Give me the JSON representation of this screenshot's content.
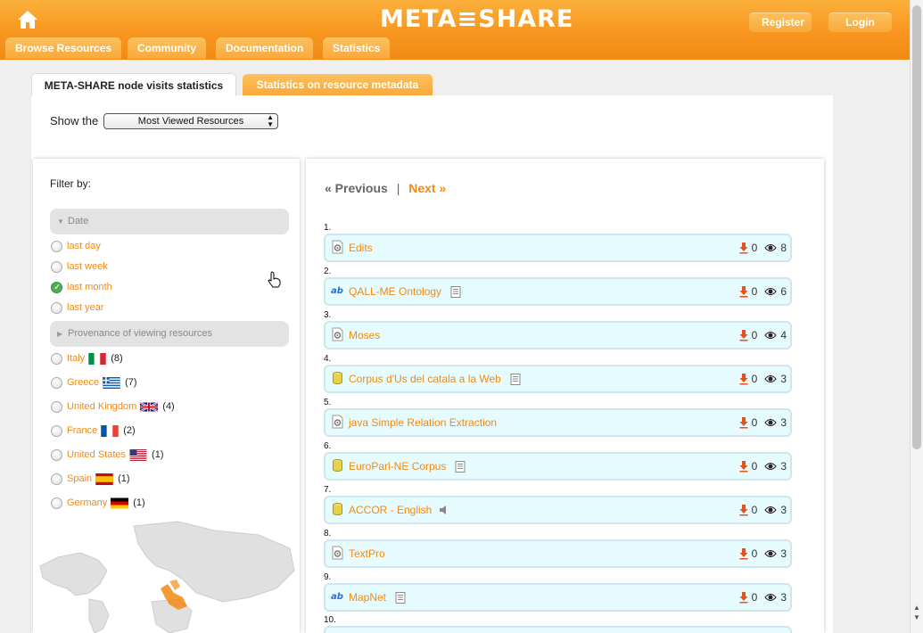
{
  "header": {
    "logo": "META≡SHARE",
    "register_label": "Register",
    "login_label": "Login",
    "nav": [
      "Browse Resources",
      "Community",
      "Documentation",
      "Statistics"
    ]
  },
  "tabs": {
    "active": "META-SHARE node visits statistics",
    "inactive": "Statistics on resource metadata"
  },
  "show": {
    "label": "Show the",
    "selected": "Most Viewed Resources"
  },
  "filter": {
    "title": "Filter by:",
    "date_facet": "Date",
    "date_options": [
      "last day",
      "last week",
      "last month",
      "last year"
    ],
    "date_selected": "last month",
    "provenance_facet": "Provenance of viewing resources",
    "countries": [
      {
        "name": "Italy",
        "count": "(8)",
        "flag": "italy"
      },
      {
        "name": "Greece",
        "count": "(7)",
        "flag": "greece"
      },
      {
        "name": "United Kingdom",
        "count": "(4)",
        "flag": "uk"
      },
      {
        "name": "France",
        "count": "(2)",
        "flag": "france"
      },
      {
        "name": "United States",
        "count": "(1)",
        "flag": "usa"
      },
      {
        "name": "Spain",
        "count": "(1)",
        "flag": "spain"
      },
      {
        "name": "Germany",
        "count": "(1)",
        "flag": "germany"
      }
    ]
  },
  "pager": {
    "previous": "« Previous",
    "separator": "|",
    "next": "Next »"
  },
  "resources": [
    {
      "rank": "1.",
      "name": "Edits",
      "type": "tool",
      "extra": "",
      "downloads": "0",
      "views": "8"
    },
    {
      "rank": "2.",
      "name": "QALL-ME Ontology",
      "type": "lexical",
      "extra": "doc",
      "downloads": "0",
      "views": "6"
    },
    {
      "rank": "3.",
      "name": "Moses",
      "type": "tool",
      "extra": "",
      "downloads": "0",
      "views": "4"
    },
    {
      "rank": "4.",
      "name": "Corpus d'Us del catala a la Web",
      "type": "corpus",
      "extra": "doc",
      "downloads": "0",
      "views": "3"
    },
    {
      "rank": "5.",
      "name": "java Simple Relation Extraction",
      "type": "tool",
      "extra": "",
      "downloads": "0",
      "views": "3"
    },
    {
      "rank": "6.",
      "name": "EuroParl-NE Corpus",
      "type": "corpus",
      "extra": "doc",
      "downloads": "0",
      "views": "3"
    },
    {
      "rank": "7.",
      "name": "ACCOR - English",
      "type": "corpus",
      "extra": "audio",
      "downloads": "0",
      "views": "3"
    },
    {
      "rank": "8.",
      "name": "TextPro",
      "type": "tool",
      "extra": "",
      "downloads": "0",
      "views": "3"
    },
    {
      "rank": "9.",
      "name": "MapNet",
      "type": "lexical",
      "extra": "doc",
      "downloads": "0",
      "views": "3"
    }
  ],
  "next_rank": "10.",
  "colors": {
    "accent": "#f28a14",
    "header": "#f7941d",
    "item_bg": "#e6fbfd"
  }
}
